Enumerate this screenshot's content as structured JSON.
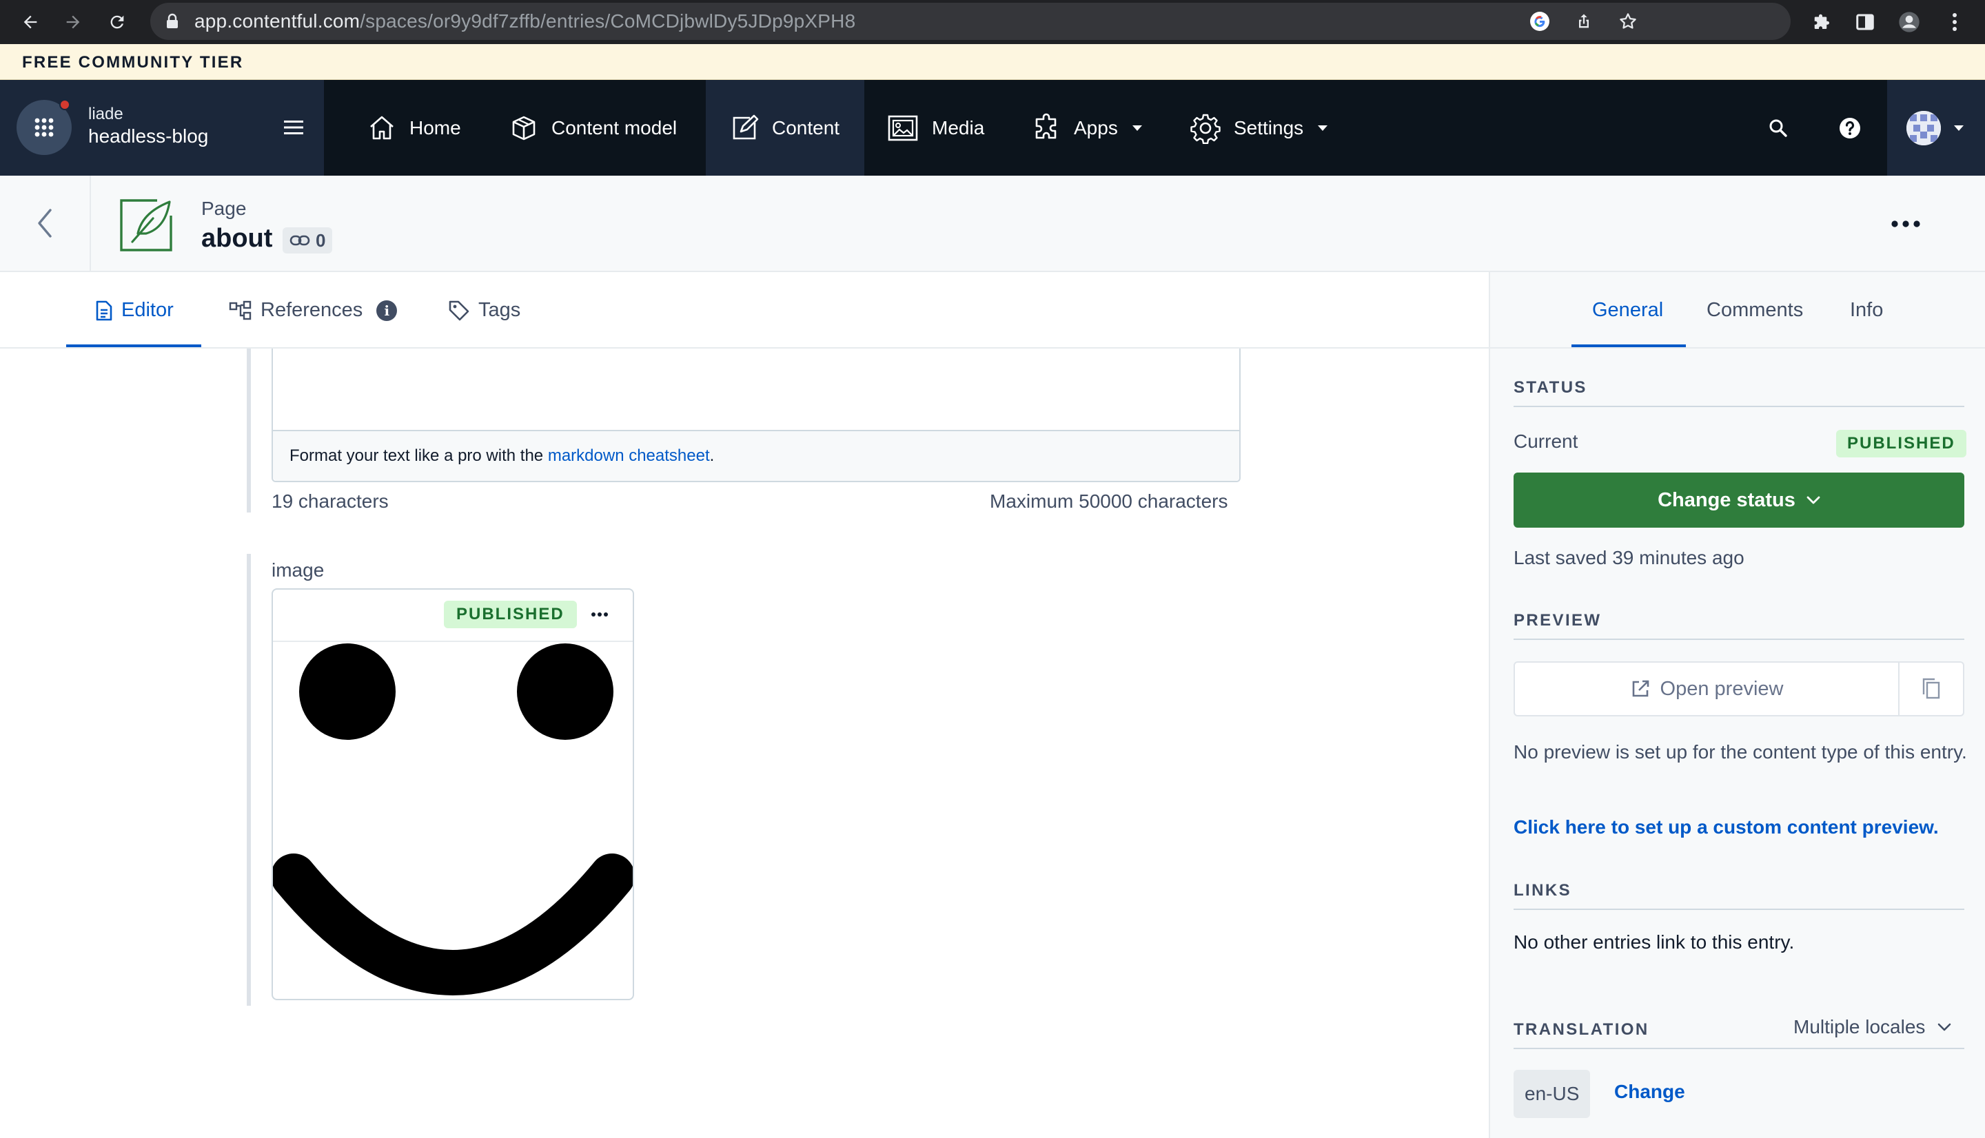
{
  "browser": {
    "url_host": "app.contentful.com",
    "url_path": "/spaces/or9y9df7zffb/entries/CoMCDjbwlDy5JDp9pXPH8"
  },
  "banner": {
    "text": "FREE COMMUNITY TIER"
  },
  "space": {
    "org": "liade",
    "name": "headless-blog"
  },
  "nav": {
    "home": "Home",
    "content_model": "Content model",
    "content": "Content",
    "media": "Media",
    "apps": "Apps",
    "settings": "Settings"
  },
  "entry": {
    "content_type": "Page",
    "title": "about",
    "references_count": "0"
  },
  "tabs": {
    "editor": "Editor",
    "references": "References",
    "tags": "Tags"
  },
  "editor": {
    "markdown_hint": "Format your text like a pro with the",
    "markdown_link": "markdown cheatsheet",
    "markdown_suffix": ".",
    "char_count": "19 characters",
    "char_max": "Maximum 50000 characters",
    "image_field_label": "image",
    "asset_status": "PUBLISHED"
  },
  "sidebar": {
    "tabs": {
      "general": "General",
      "comments": "Comments",
      "info": "Info"
    },
    "status": {
      "heading": "STATUS",
      "current_label": "Current",
      "current_value": "PUBLISHED",
      "change_button": "Change status",
      "last_saved": "Last saved 39 minutes ago"
    },
    "preview": {
      "heading": "PREVIEW",
      "open_button": "Open preview",
      "note": "No preview is set up for the content type of this entry.",
      "setup_link": "Click here to set up a custom content preview."
    },
    "links": {
      "heading": "LINKS",
      "note": "No other entries link to this entry."
    },
    "translation": {
      "heading": "TRANSLATION",
      "mode": "Multiple locales",
      "locale": "en-US",
      "change": "Change"
    }
  },
  "colors": {
    "primary": "#0059c8",
    "success": "#2f7d3c",
    "badge_bg": "#d5f7d5",
    "nav_bg": "#0c141c",
    "banner_bg": "#fdf6e0"
  }
}
